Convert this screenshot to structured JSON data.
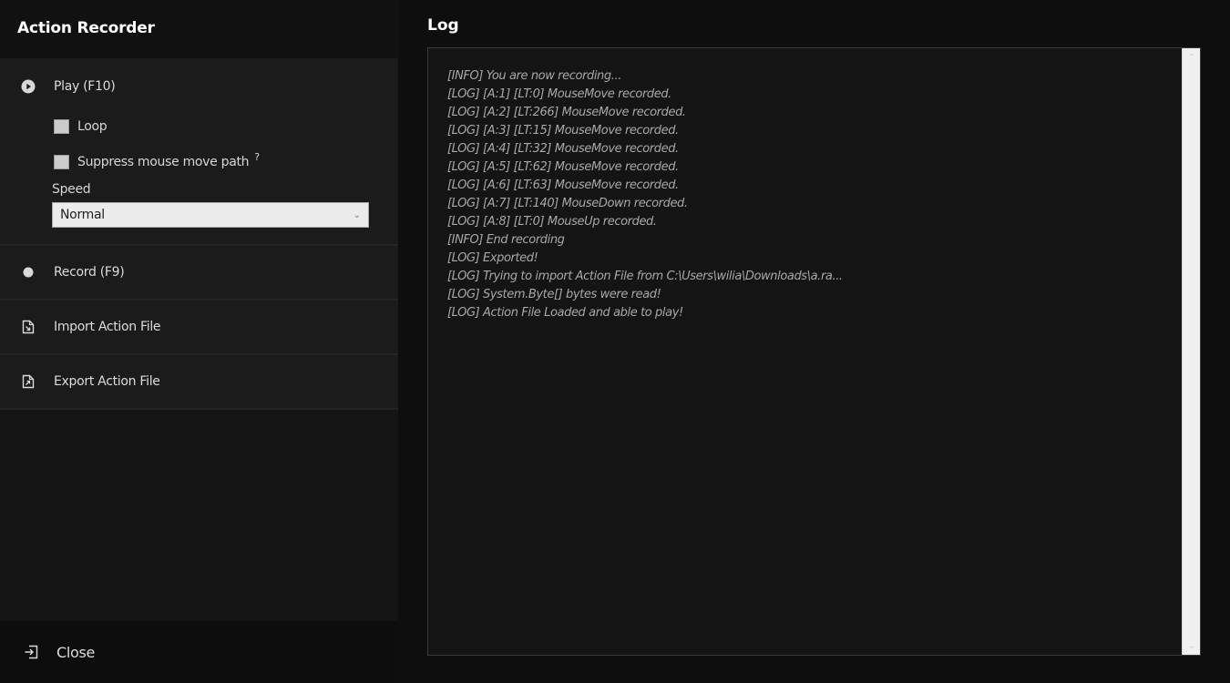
{
  "app": {
    "title": "Action Recorder"
  },
  "menu": {
    "play": {
      "label": "Play (F10)",
      "icon": "play-circle-icon",
      "options": {
        "loop": {
          "label": "Loop",
          "checked": false
        },
        "suppress": {
          "label": "Suppress mouse move path",
          "checked": false,
          "help": "?"
        }
      },
      "speed": {
        "label": "Speed",
        "selected": "Normal"
      }
    },
    "record": {
      "label": "Record (F9)",
      "icon": "record-dot-icon"
    },
    "import": {
      "label": "Import Action File",
      "icon": "file-import-icon"
    },
    "export": {
      "label": "Export Action File",
      "icon": "file-export-icon"
    }
  },
  "footer": {
    "close_label": "Close",
    "icon": "exit-icon"
  },
  "log": {
    "title": "Log",
    "lines": [
      "[INFO] You are now recording...",
      "[LOG] [A:1] [LT:0] MouseMove recorded.",
      "[LOG] [A:2] [LT:266] MouseMove recorded.",
      "[LOG] [A:3] [LT:15] MouseMove recorded.",
      "[LOG] [A:4] [LT:32] MouseMove recorded.",
      "[LOG] [A:5] [LT:62] MouseMove recorded.",
      "[LOG] [A:6] [LT:63] MouseMove recorded.",
      "[LOG] [A:7] [LT:140] MouseDown recorded.",
      "[LOG] [A:8] [LT:0] MouseUp recorded.",
      "[INFO] End recording",
      "[LOG] Exported!",
      "[LOG] Trying to import Action File from C:\\Users\\wilia\\Downloads\\a.ra...",
      "[LOG] System.Byte[] bytes were read!",
      "[LOG] Action File Loaded and able to play!"
    ]
  },
  "colors": {
    "background": "#0e0e0e",
    "panel": "#1b1b1b",
    "text": "#dcdcdc",
    "log_text": "#a8a8a8"
  }
}
